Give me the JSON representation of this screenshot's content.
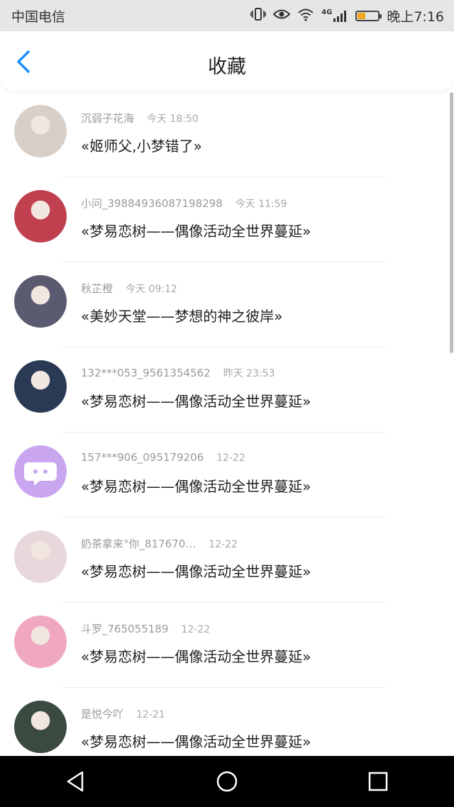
{
  "status_bar": {
    "carrier": "中国电信",
    "network": "4G",
    "time": "晚上7:16",
    "battery_level": 0.35,
    "icons": [
      "vibrate-icon",
      "eye-icon",
      "wifi-icon",
      "signal-icon",
      "battery-icon"
    ]
  },
  "header": {
    "title": "收藏",
    "back_icon": "chevron-left-icon",
    "accent_color": "#1e90ff"
  },
  "items": [
    {
      "user": "沉弱子花海",
      "time": "今天 18:50",
      "song": "«姬师父,小梦错了»",
      "avatar_color": "#d8d0c8"
    },
    {
      "user": "小问_39884936087198298",
      "time": "今天 11:59",
      "song": "«梦易恋树——偶像活动全世界蔓延»",
      "avatar_color": "#c04050"
    },
    {
      "user": "秋芷橙",
      "time": "今天 09:12",
      "song": "«美妙天堂——梦想的神之彼岸»",
      "avatar_color": "#5a5a70"
    },
    {
      "user": "132***053_9561354562",
      "time": "昨天 23:53",
      "song": "«梦易恋树——偶像活动全世界蔓延»",
      "avatar_color": "#2a3a55"
    },
    {
      "user": "157***906_095179206",
      "time": "12-22",
      "song": "«梦易恋树——偶像活动全世界蔓延»",
      "avatar_color": "#c9a6ef"
    },
    {
      "user": "奶茶拿来°你_817670…",
      "time": "12-22",
      "song": "«梦易恋树——偶像活动全世界蔓延»",
      "avatar_color": "#e8d8dc"
    },
    {
      "user": "斗罗_765055189",
      "time": "12-22",
      "song": "«梦易恋树——偶像活动全世界蔓延»",
      "avatar_color": "#f0a8c0"
    },
    {
      "user": "是悦今吖",
      "time": "12-21",
      "song": "«梦易恋树——偶像活动全世界蔓延»",
      "avatar_color": "#3a4a40"
    }
  ],
  "navbar": {
    "buttons": [
      "back-triangle-icon",
      "home-circle-icon",
      "recents-square-icon"
    ]
  }
}
